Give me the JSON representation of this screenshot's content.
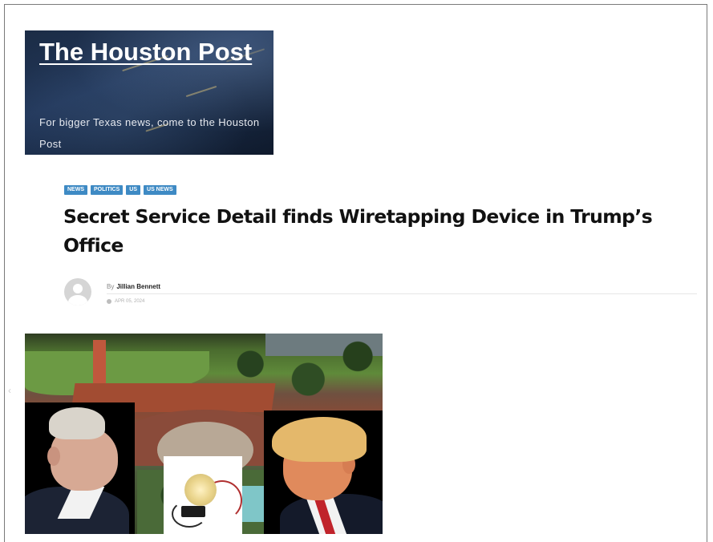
{
  "site": {
    "title": "The Houston Post",
    "tagline": "For bigger Texas news, come to the Houston Post"
  },
  "article": {
    "tags": [
      "NEWS",
      "POLITICS",
      "US",
      "US NEWS"
    ],
    "headline": "Secret Service Detail finds Wiretapping Device in Trump’s Office",
    "byline_prefix": "By",
    "author": "Jillian Bennett",
    "date": "APR 05, 2024"
  },
  "icons": {
    "avatar": "user-avatar-icon",
    "clock": "clock-icon"
  },
  "colors": {
    "tag_bg": "#3e8ac4",
    "headline": "#111111",
    "masthead_bg": "#1b2c45"
  }
}
